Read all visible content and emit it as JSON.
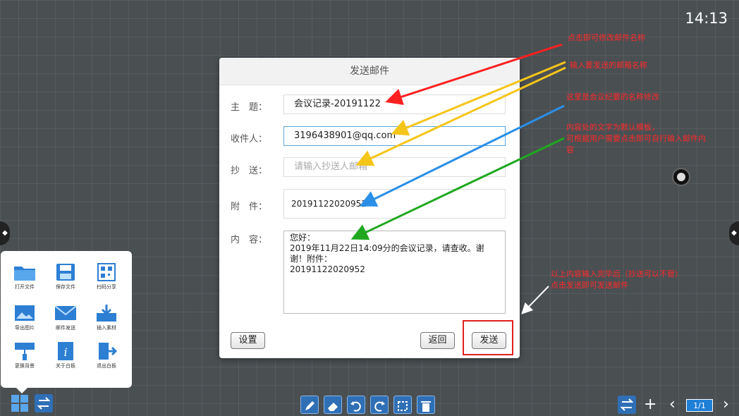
{
  "status": {
    "clock": "14:13"
  },
  "dialog": {
    "title": "发送邮件",
    "subject": {
      "label": "主　题：",
      "value": "会议记录-20191122"
    },
    "recipient": {
      "label": "收件人：",
      "value": "3196438901@qq.com"
    },
    "cc": {
      "label": "抄　送：",
      "placeholder": "请输入抄送人邮箱"
    },
    "attachment": {
      "label": "附　件：",
      "value": "20191122020952"
    },
    "content": {
      "label": "内　容：",
      "lines": [
        "您好：",
        "2019年11月22日14:09分的会议记录，请查收。谢",
        "谢！附件：",
        "20191122020952"
      ]
    },
    "buttons": {
      "settings": "设置",
      "back": "返回",
      "send": "发送"
    }
  },
  "annotations": {
    "n1": "点击即可修改邮件名称",
    "n2": "输入要发送的邮箱名称",
    "n3": "这里是会议纪要的名称修改",
    "n4a": "内容处的文字为默认模板，",
    "n4b": "可根据用户需要点击即可自行输入邮件内",
    "n4c": "容",
    "n5a": "以上内容输入完毕后（抄送可以不管）",
    "n5b": "点击发送即可发送邮件",
    "colors": {
      "red": "#ff2020",
      "yellow": "#f5c518",
      "blue": "#2a8fe8",
      "green": "#1fa81f",
      "white": "#ffffff"
    }
  },
  "menu": {
    "items": [
      {
        "label": "打开文件",
        "icon": "folder-icon"
      },
      {
        "label": "保存文件",
        "icon": "save-icon"
      },
      {
        "label": "扫码分享",
        "icon": "qr-code-icon"
      },
      {
        "label": "导出图片",
        "icon": "image-icon"
      },
      {
        "label": "邮件发送",
        "icon": "mail-icon"
      },
      {
        "label": "插入素材",
        "icon": "download-tray-icon"
      },
      {
        "label": "更换背景",
        "icon": "paint-roller-icon"
      },
      {
        "label": "关于白板",
        "icon": "info-icon"
      },
      {
        "label": "退出白板",
        "icon": "exit-icon"
      }
    ]
  },
  "toolbar": {
    "page": "1/1"
  }
}
